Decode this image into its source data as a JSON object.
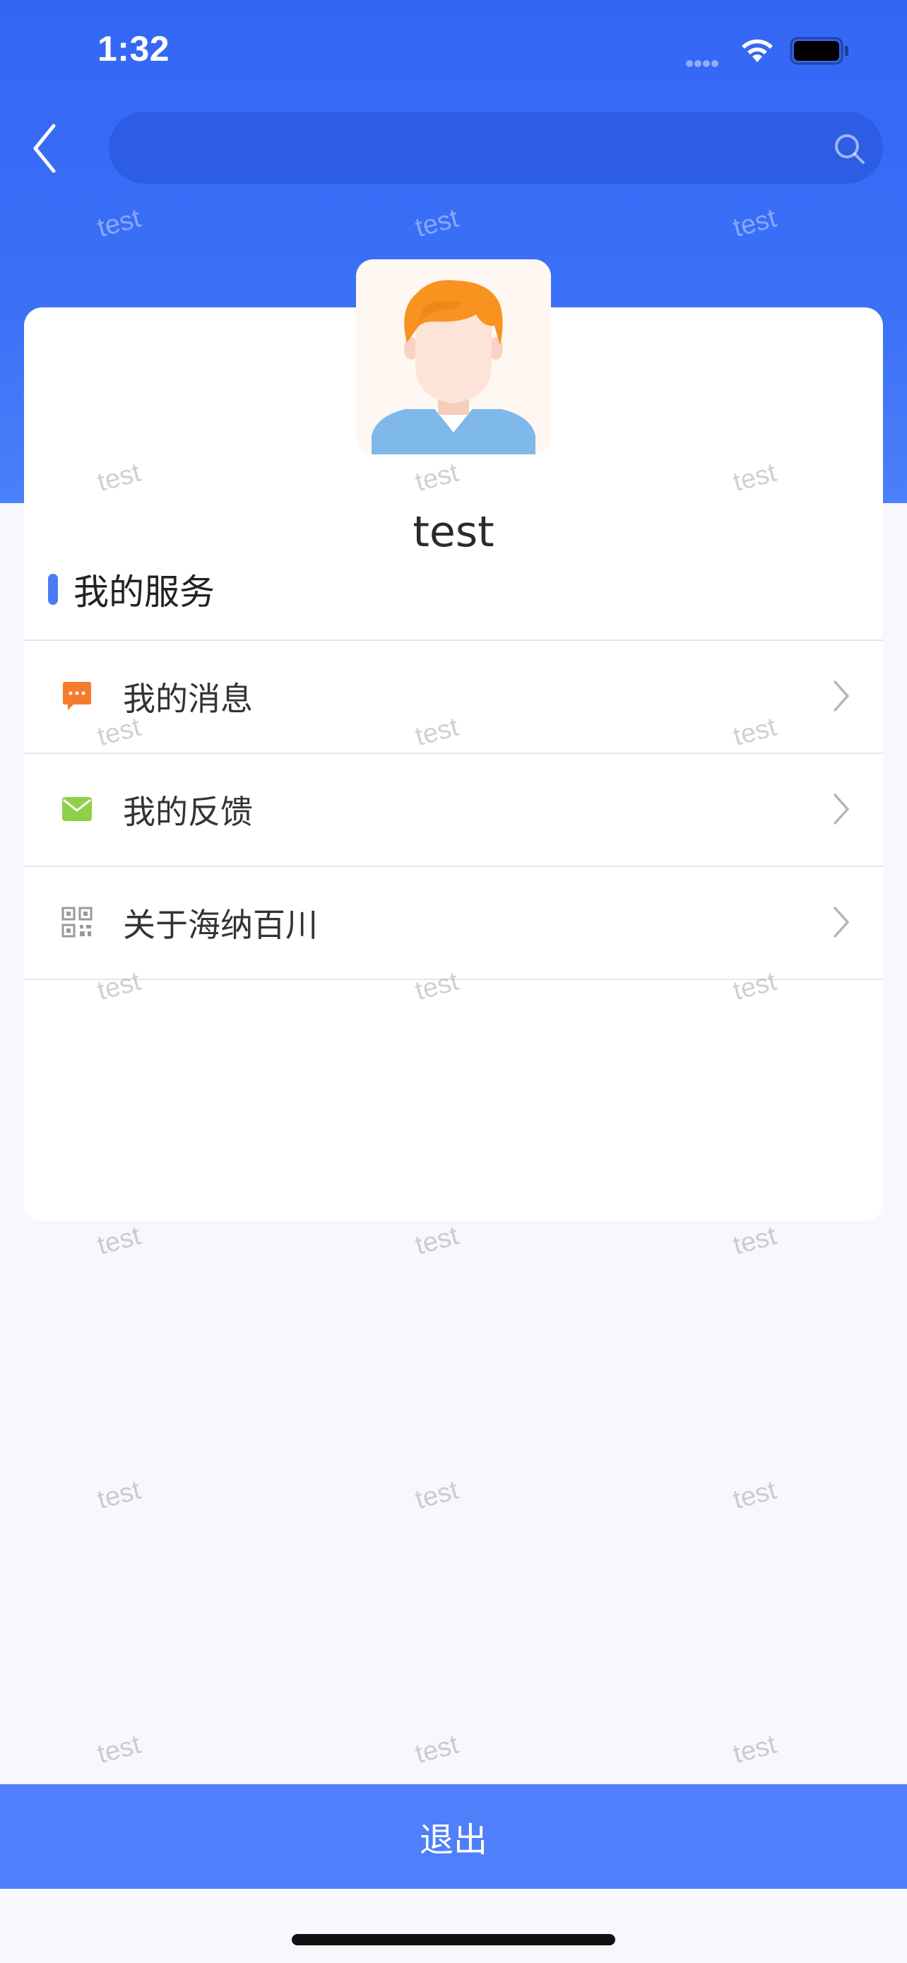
{
  "status_bar": {
    "time": "1:32"
  },
  "nav": {
    "search_placeholder": ""
  },
  "profile": {
    "username": "test"
  },
  "section": {
    "title": "我的服务"
  },
  "menu": {
    "items": [
      {
        "label": "我的消息",
        "icon": "message-icon",
        "icon_color": "#f47c2c"
      },
      {
        "label": "我的反馈",
        "icon": "mail-icon",
        "icon_color": "#8fd04a"
      },
      {
        "label": "关于海纳百川",
        "icon": "qrcode-icon",
        "icon_color": "#9a9a9a"
      }
    ]
  },
  "watermark": {
    "text": "test"
  },
  "logout": {
    "label": "退出"
  },
  "colors": {
    "brand_blue": "#3366f5",
    "button_blue": "#4f7ffb",
    "accent_marker": "#4a7cf7"
  }
}
